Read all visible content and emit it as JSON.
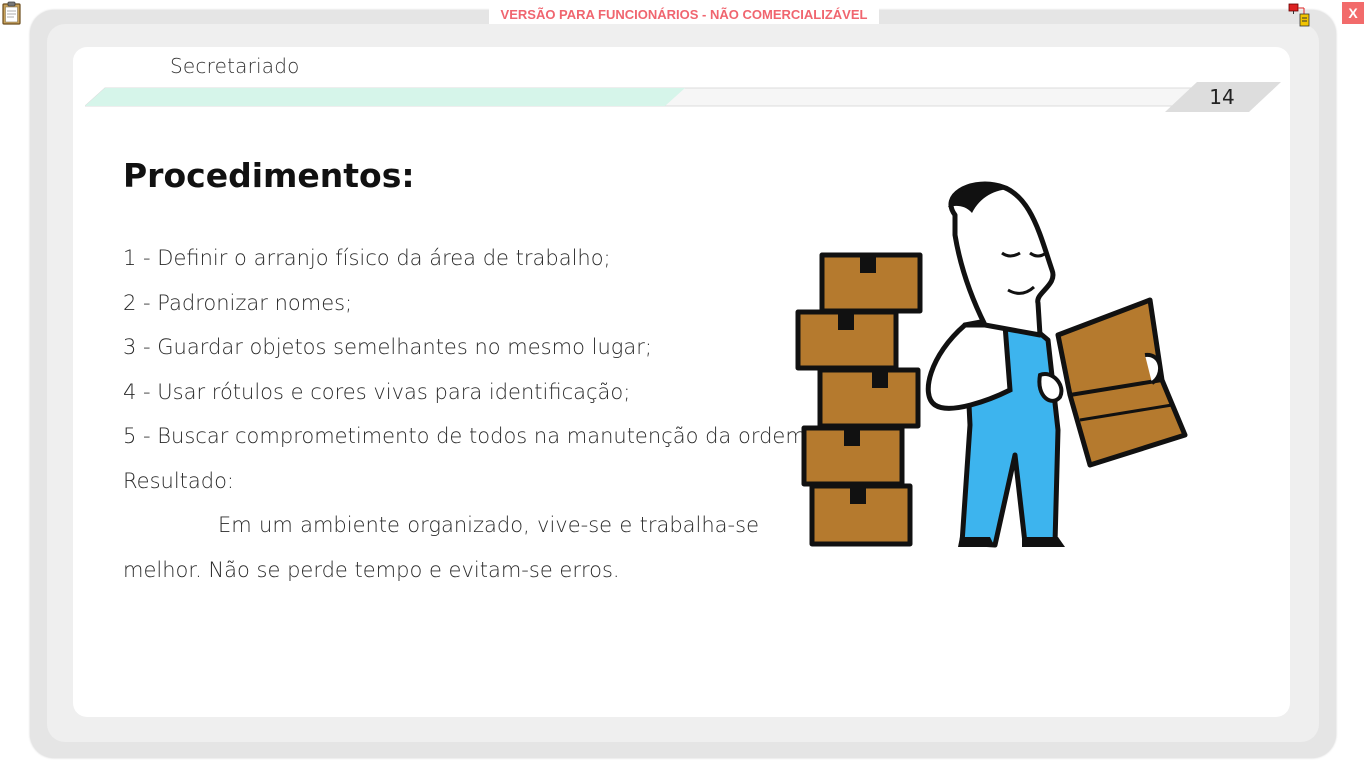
{
  "watermark": "VERSÃO PARA FUNCIONÁRIOS - NÃO COMERCIALIZÁVEL",
  "close_label": "X",
  "header": {
    "section_title": "Secretariado",
    "page_number": "14"
  },
  "slide": {
    "heading": "Procedimentos:",
    "steps": [
      "1 - Definir o arranjo físico da área de trabalho;",
      "2 - Padronizar nomes;",
      "3 - Guardar objetos semelhantes no mesmo lugar;",
      "4 - Usar rótulos e cores vivas para identificação;",
      "5 - Buscar comprometimento de todos na manutenção da ordem."
    ],
    "result_label": "Resultado:",
    "result_text": "Em um ambiente organizado, vive-se e trabalha-se melhor. Não se perde tempo e evitam-se erros."
  },
  "icons": {
    "top_left": "clipboard-icon",
    "top_right": "network-icon",
    "illustration": "worker-with-boxes-illustration"
  },
  "colors": {
    "accent_bar": "#d6f5ea",
    "watermark": "#f0656f",
    "close_button": "#f26b6b",
    "box_fill": "#b57a2e",
    "overalls": "#3db4ee"
  }
}
